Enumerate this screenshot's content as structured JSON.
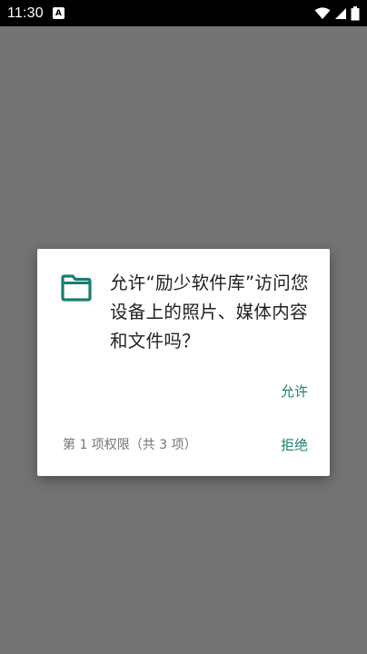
{
  "status_bar": {
    "time": "11:30",
    "notification_icon_letter": "A",
    "wifi_icon": "wifi-icon",
    "signal_icon": "signal-icon",
    "battery_icon": "battery-icon"
  },
  "dialog": {
    "icon": "folder-icon",
    "message": "允许“励少软件库”访问您设备上的照片、媒体内容和文件吗？",
    "allow_label": "允许",
    "page_indicator": "第 1 项权限（共 3 项）",
    "deny_label": "拒绝"
  },
  "colors": {
    "accent": "#1b7d71",
    "scrim": "#737373",
    "status_bar": "#000000"
  }
}
